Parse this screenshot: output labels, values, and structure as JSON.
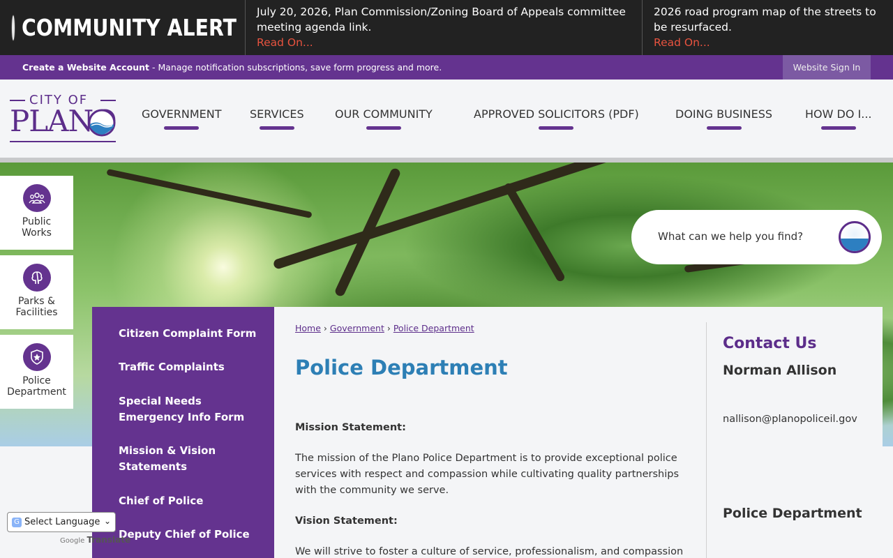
{
  "alert": {
    "title": "COMMUNITY ALERT",
    "items": [
      {
        "text": "July 20, 2026, Plan Commission/Zoning Board of Appeals committee meeting agenda link.",
        "link": "Read On..."
      },
      {
        "text": "2026 road program map of the streets to be resurfaced.",
        "link": "Read On..."
      }
    ]
  },
  "account_bar": {
    "create_label": "Create a Website Account",
    "description": " - Manage notification subscriptions, save form progress and more.",
    "signin_label": "Website Sign In"
  },
  "logo": {
    "top": "CITY OF",
    "name": "PLANO"
  },
  "nav": [
    {
      "label": "GOVERNMENT"
    },
    {
      "label": "SERVICES"
    },
    {
      "label": "OUR COMMUNITY"
    },
    {
      "label": "APPROVED SOLICITORS (PDF)"
    },
    {
      "label": "DOING BUSINESS"
    },
    {
      "label": "HOW DO I..."
    }
  ],
  "quick_links": [
    {
      "label_line1": "Public",
      "label_line2": "Works",
      "icon": "people-icon"
    },
    {
      "label_line1": "Parks &",
      "label_line2": "Facilities",
      "icon": "tree-icon"
    },
    {
      "label_line1": "Police",
      "label_line2": "Department",
      "icon": "badge-icon"
    }
  ],
  "search": {
    "placeholder": "What can we help you find?"
  },
  "sidenav": [
    {
      "line1": "Citizen Complaint Form",
      "line2": ""
    },
    {
      "line1": "Traffic Complaints",
      "line2": ""
    },
    {
      "line1": "Special Needs",
      "line2": "Emergency Info Form"
    },
    {
      "line1": "Mission & Vision",
      "line2": "Statements"
    },
    {
      "line1": "Chief of Police",
      "line2": ""
    },
    {
      "line1": "Deputy Chief of Police",
      "line2": ""
    }
  ],
  "breadcrumb": {
    "home": "Home",
    "government": "Government",
    "current": "Police Department",
    "sep": "›"
  },
  "page": {
    "title": "Police Department",
    "mission_heading": "Mission Statement:",
    "mission_text": "The mission of the Plano Police Department is to provide exceptional police services with respect and compassion while cultivating quality partnerships with the community we serve.",
    "vision_heading": "Vision Statement:",
    "vision_text": "We will strive to foster a culture of service, professionalism, and compassion"
  },
  "contact": {
    "title": "Contact Us",
    "name": "Norman Allison",
    "email": "nallison@planopoliceil.gov",
    "dept": "Police Department"
  },
  "translate": {
    "select_label": "Select Language",
    "powered_by": "Google",
    "translate_label": "Translate"
  },
  "colors": {
    "purple": "#64338f",
    "alert_bg": "#222222",
    "read_on": "#e8533f",
    "title_blue": "#2d7fb5"
  }
}
